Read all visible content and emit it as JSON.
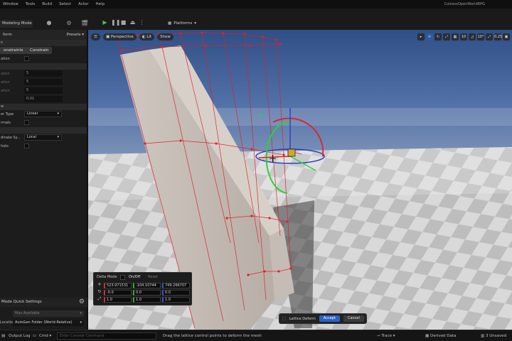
{
  "menubar": {
    "items": [
      "Window",
      "Tools",
      "Build",
      "Select",
      "Actor",
      "Help"
    ],
    "project_name": "ColossoOpenWorldRPG"
  },
  "toolbar": {
    "mode": "Modeling Mode",
    "platforms_label": "Platforms"
  },
  "left_panel": {
    "title": "form",
    "presets_label": "Presets",
    "constraints_tab": "onstraints",
    "constrain_tab": "Constrain",
    "rows": {
      "r1": "ation",
      "r2": "ation",
      "r3": "ation",
      "r4": "ation",
      "v1": "5",
      "v2": "5",
      "v3": "5",
      "v4": "0.01",
      "r5": "er Type",
      "interp": "Linear",
      "r6": "rmals",
      "r7": "dinate Sy...",
      "coord": "Local",
      "r8": "hots"
    },
    "quick_settings": {
      "title": "Mode Quick Settings",
      "max_available": "Max Available",
      "location_label": "Location",
      "location_value": "AutoGen Folder (World-Relative)"
    }
  },
  "viewport": {
    "perspective_label": "Perspective",
    "lit_label": "Lit",
    "show_label": "Show",
    "right_icons": [
      "▸",
      "✛",
      "↻",
      "⤢",
      "▦",
      "10",
      "◿",
      "10°",
      "⤢",
      "0.25",
      "▣"
    ]
  },
  "delta_panel": {
    "mode_label": "Delta Mode",
    "on_off": "On/Off",
    "reset": "Reset",
    "location": [
      "523.971531",
      "-104.10744",
      "749.266707"
    ],
    "rotation": [
      "-0.0",
      "0.0",
      "0.0"
    ],
    "scale": [
      "1.0",
      "1.0",
      "1.0"
    ]
  },
  "lattice_bar": {
    "label": "Lattice Deform",
    "accept": "Accept",
    "cancel": "Cancel"
  },
  "statusbar": {
    "output_log": "Output Log",
    "cmd": "Cmd",
    "cmd_placeholder": "Enter Console Command",
    "hint": "Drag the lattice control points to deform the mesh",
    "trace": "Trace",
    "derived_data": "Derived Data",
    "unsaved": "3 Unsaved"
  },
  "colors": {
    "sky": "#3c5d93",
    "floor_light": "#d8d8d8",
    "floor_dark": "#b9b9b9",
    "lattice": "#e0202a",
    "accent": "#2b63c4"
  }
}
